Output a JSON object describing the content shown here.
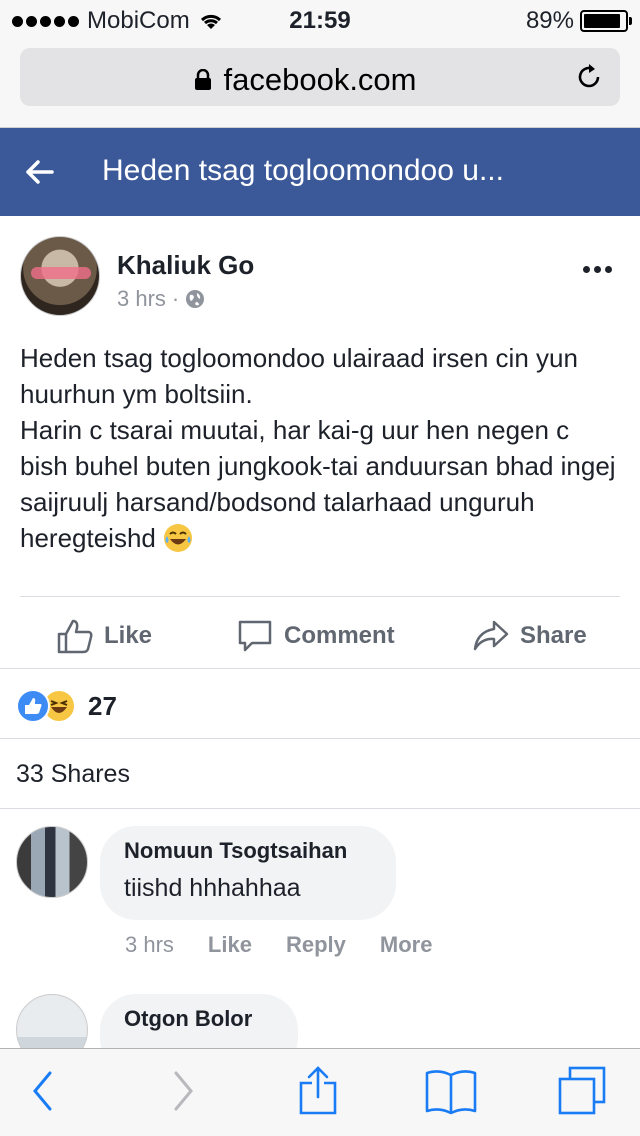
{
  "status_bar": {
    "carrier": "MobiCom",
    "time": "21:59",
    "battery_percent": "89%",
    "battery_level": 0.89
  },
  "browser": {
    "url": "facebook.com"
  },
  "header": {
    "title": "Heden tsag togloomondoo u..."
  },
  "post": {
    "author": "Khaliuk Go",
    "time": "3 hrs",
    "separator": "·",
    "text_lines": [
      "Heden tsag togloomondoo ulairaad irsen cin yun huurhun ym boltsiin.",
      "Harin c tsarai muutai, har kai-g uur hen negen c bish buhel buten jungkook-tai anduursan bhad ingej saijruulj harsand/bodsond talarhaad unguruh heregteishd"
    ],
    "emoji_icon": "tears-of-joy-emoji",
    "actions": {
      "like": "Like",
      "comment": "Comment",
      "share": "Share"
    },
    "reaction_count": "27",
    "shares": "33 Shares"
  },
  "comments": [
    {
      "name": "Nomuun Tsogtsaihan",
      "text": "tiishd hhhahhaa",
      "time": "3 hrs",
      "like": "Like",
      "reply": "Reply",
      "more": "More"
    },
    {
      "name": "Otgon Bolor"
    }
  ],
  "colors": {
    "facebook_blue": "#3b5998",
    "ios_blue": "#1a7cf5",
    "bubble_bg": "#f2f3f5"
  }
}
